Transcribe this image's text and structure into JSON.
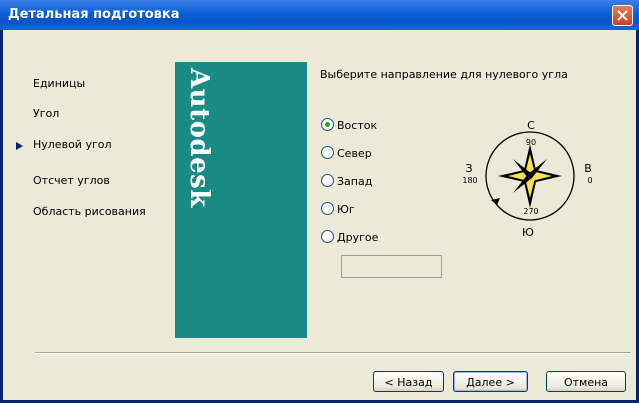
{
  "window": {
    "title": "Детальная подготовка"
  },
  "sidebar": {
    "items": [
      {
        "label": "Единицы",
        "active": false
      },
      {
        "label": "Угол",
        "active": false
      },
      {
        "label": "Нулевой угол",
        "active": true
      },
      {
        "label": "Отсчет углов",
        "active": false
      },
      {
        "label": "Область рисования",
        "active": false
      }
    ]
  },
  "banner": {
    "logo_text": "Autodesk"
  },
  "main": {
    "prompt": "Выберите направление для нулевого угла",
    "options": [
      {
        "label": "Восток",
        "selected": true
      },
      {
        "label": "Север",
        "selected": false
      },
      {
        "label": "Запад",
        "selected": false
      },
      {
        "label": "Юг",
        "selected": false
      },
      {
        "label": "Другое",
        "selected": false
      }
    ],
    "other_value": "",
    "compass": {
      "north": "С",
      "south": "Ю",
      "east": "В",
      "west": "З",
      "deg_north": "90",
      "deg_south": "270",
      "deg_east": "0",
      "deg_west": "180"
    }
  },
  "buttons": {
    "back": "< Назад",
    "next": "Далее >",
    "cancel": "Отмена"
  },
  "colors": {
    "banner": "#1a8a85",
    "titlebar": "#0a5fd8",
    "accent": "#0a246a"
  }
}
